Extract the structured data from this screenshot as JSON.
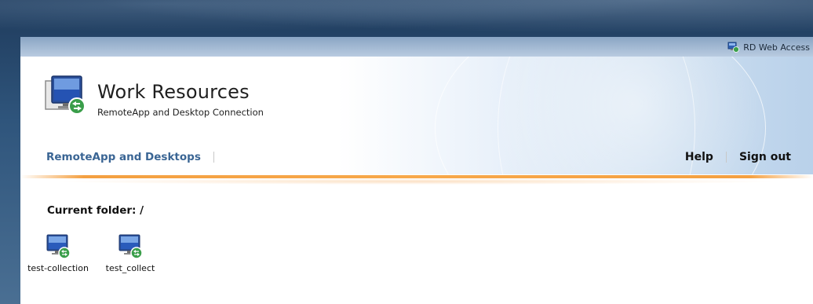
{
  "topbar": {
    "link_label": "RD Web Access"
  },
  "header": {
    "title": "Work Resources",
    "subtitle": "RemoteApp and Desktop Connection"
  },
  "nav": {
    "left_tab": "RemoteApp and Desktops",
    "help": "Help",
    "sign_out": "Sign out"
  },
  "main": {
    "current_folder": "Current folder: /",
    "items": [
      {
        "label": "test-collection",
        "icon": "remote-desktop-icon"
      },
      {
        "label": "test_collect",
        "icon": "remote-desktop-icon"
      }
    ]
  },
  "colors": {
    "nav_blue": "#3a6594",
    "accent_orange": "#f4a041",
    "topbar_blue": "#8aa5c4"
  }
}
